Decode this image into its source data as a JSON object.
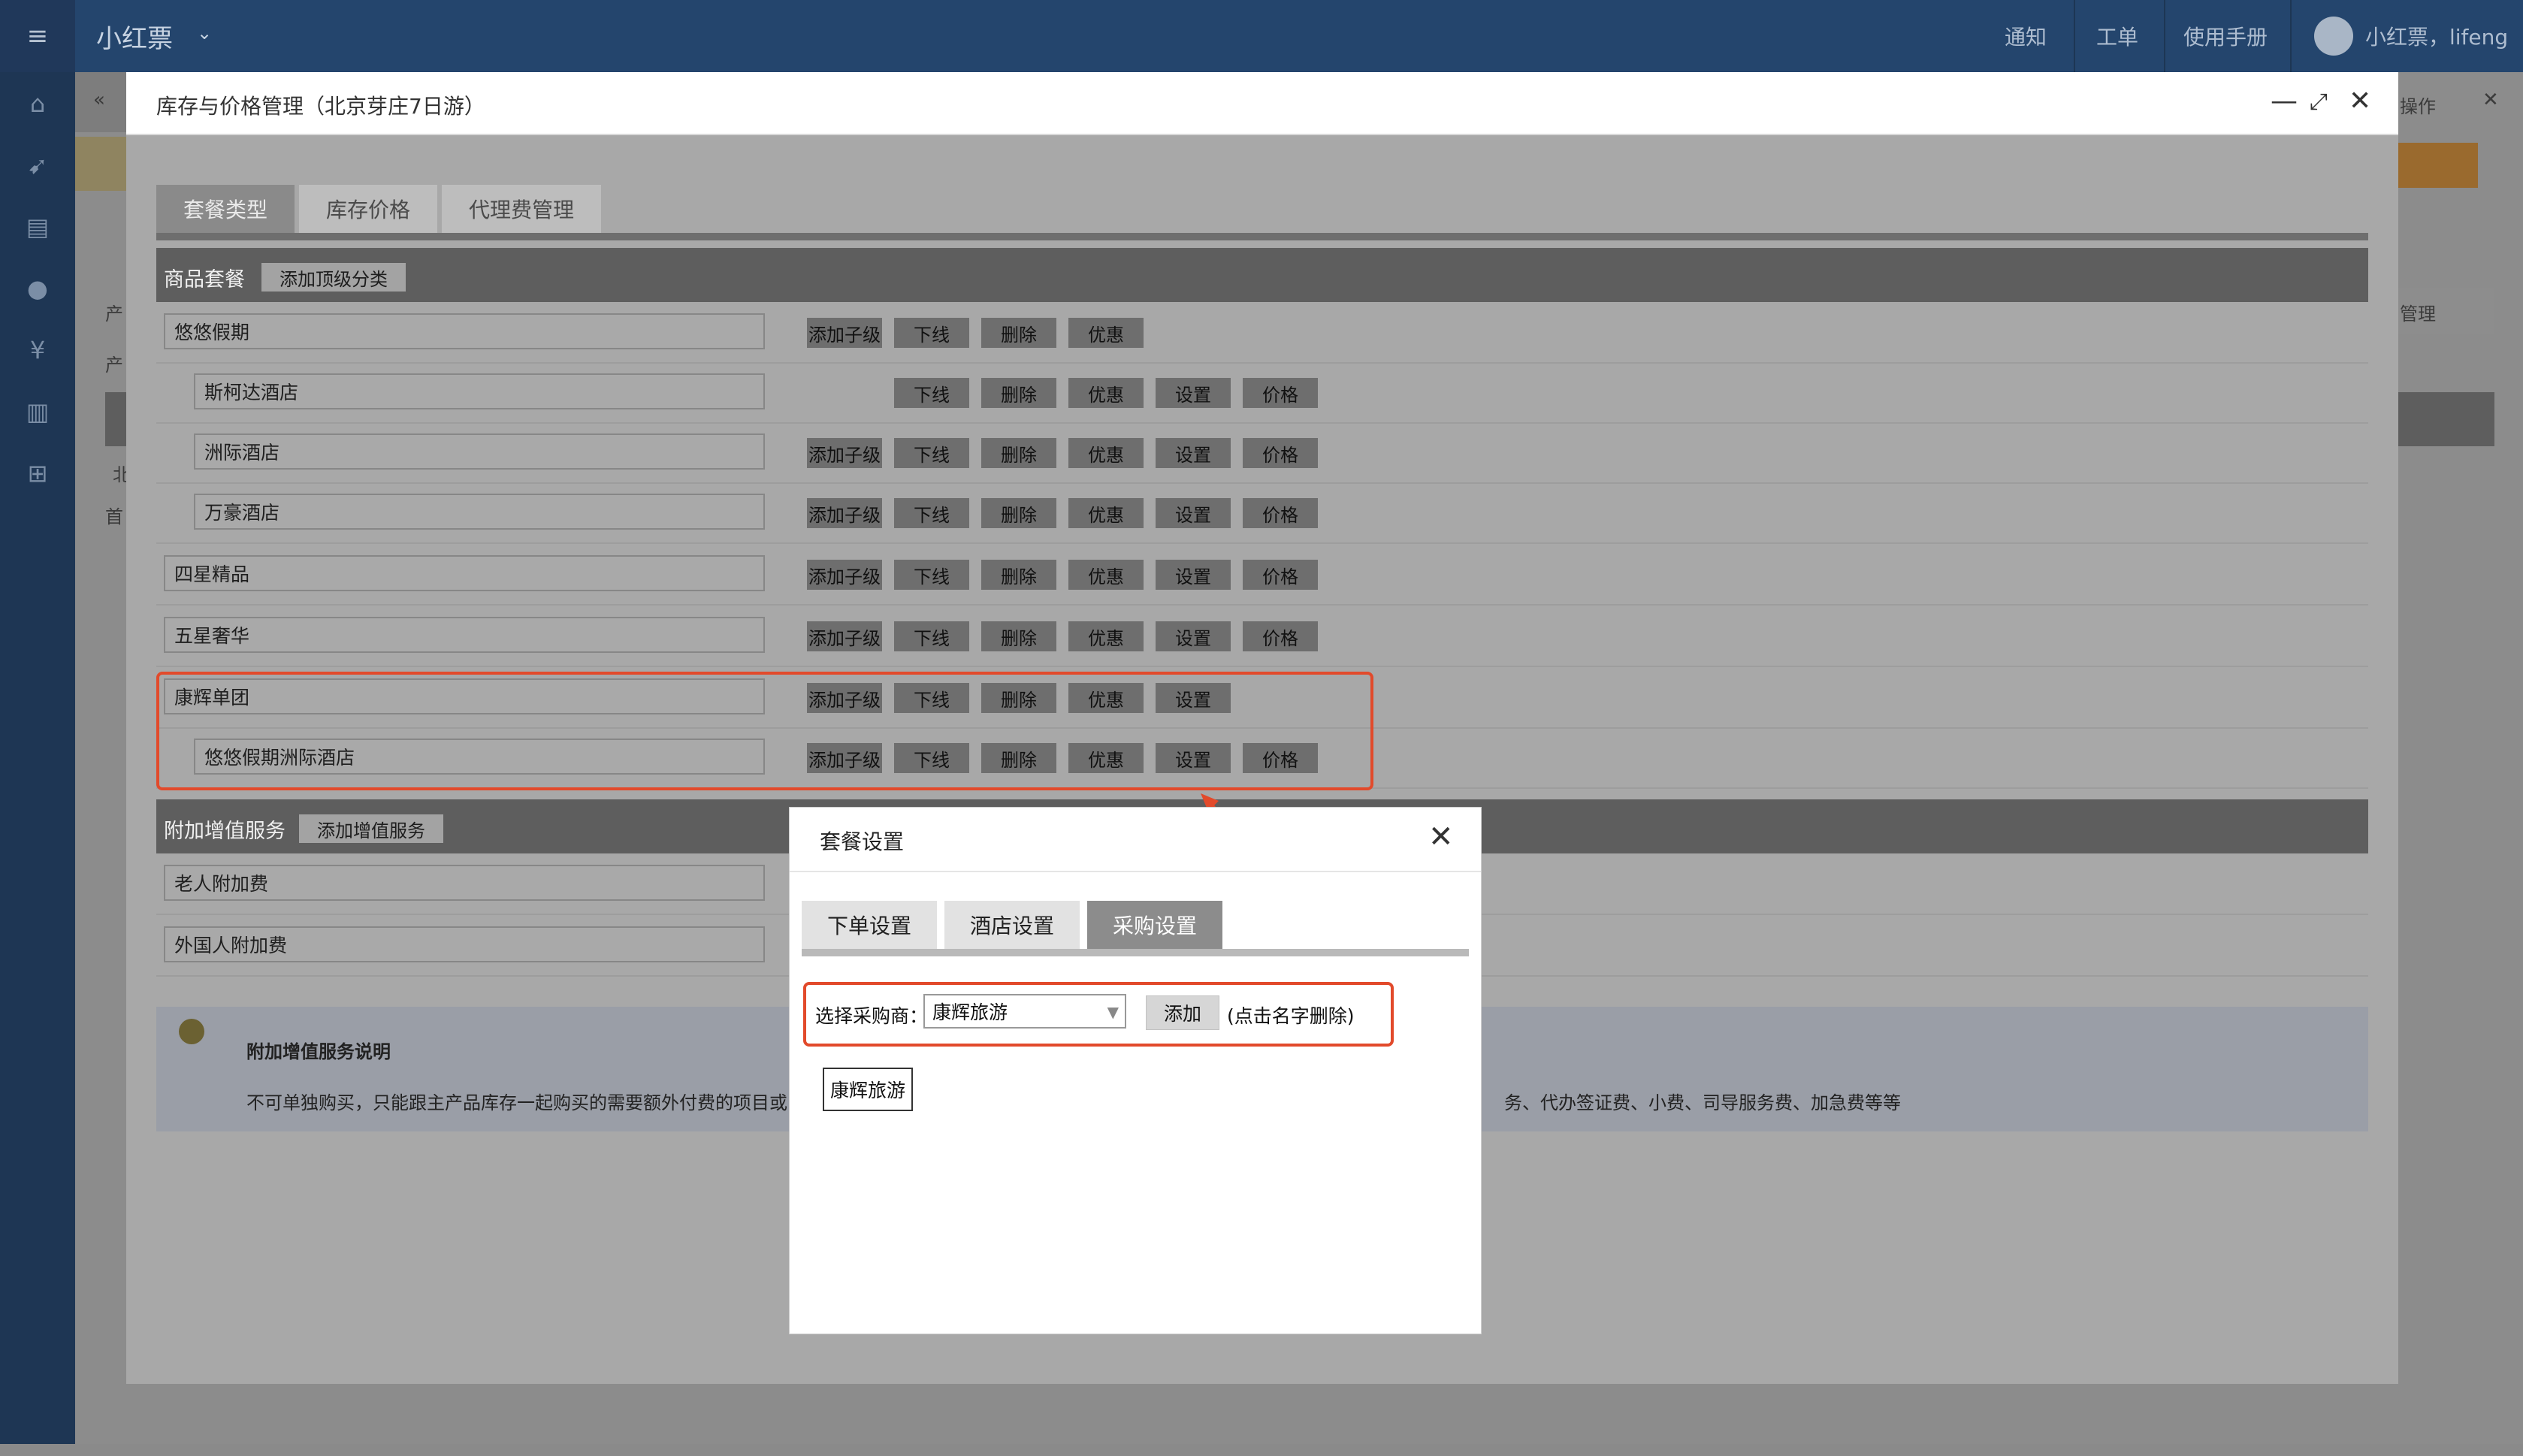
{
  "app": {
    "brand": "小红票",
    "nav": {
      "notify": "通知",
      "ticket": "工单",
      "manual": "使用手册",
      "user": "小红票，lifeng"
    },
    "right_menu": "操作",
    "bg_fragments": {
      "manage": "管理",
      "chan1": "产",
      "chan2": "产",
      "north": "北",
      "first": "首"
    }
  },
  "modal": {
    "title": "库存与价格管理（北京芽庄7日游）",
    "tabs": [
      "套餐类型",
      "库存价格",
      "代理费管理"
    ],
    "section_main": {
      "title": "商品套餐",
      "button": "添加顶级分类"
    },
    "actions": {
      "add_child": "添加子级",
      "offline": "下线",
      "delete": "删除",
      "discount": "优惠",
      "settings": "设置",
      "price": "价格"
    },
    "rows": [
      {
        "name": "悠悠假期"
      },
      {
        "name": "斯柯达酒店"
      },
      {
        "name": "洲际酒店"
      },
      {
        "name": "万豪酒店"
      },
      {
        "name": "四星精品"
      },
      {
        "name": "五星奢华"
      },
      {
        "name": "康辉单团"
      },
      {
        "name": "悠悠假期洲际酒店"
      }
    ],
    "section_addon": {
      "title": "附加增值服务",
      "button": "添加增值服务"
    },
    "addon_rows": [
      {
        "name": "老人附加费"
      },
      {
        "name": "外国人附加费"
      }
    ],
    "note": {
      "title": "附加增值服务说明",
      "text_left": "不可单独购买，只能跟主产品库存一起购买的需要额外付费的项目或",
      "text_right": "务、代办签证费、小费、司导服务费、加急费等等"
    }
  },
  "popup": {
    "title": "套餐设置",
    "tabs": [
      "下单设置",
      "酒店设置",
      "采购设置"
    ],
    "active_tab": "采购设置",
    "supplier_label": "选择采购商：",
    "supplier_value": "康辉旅游",
    "add_button": "添加",
    "hint": "(点击名字删除)",
    "selected_tag": "康辉旅游"
  }
}
